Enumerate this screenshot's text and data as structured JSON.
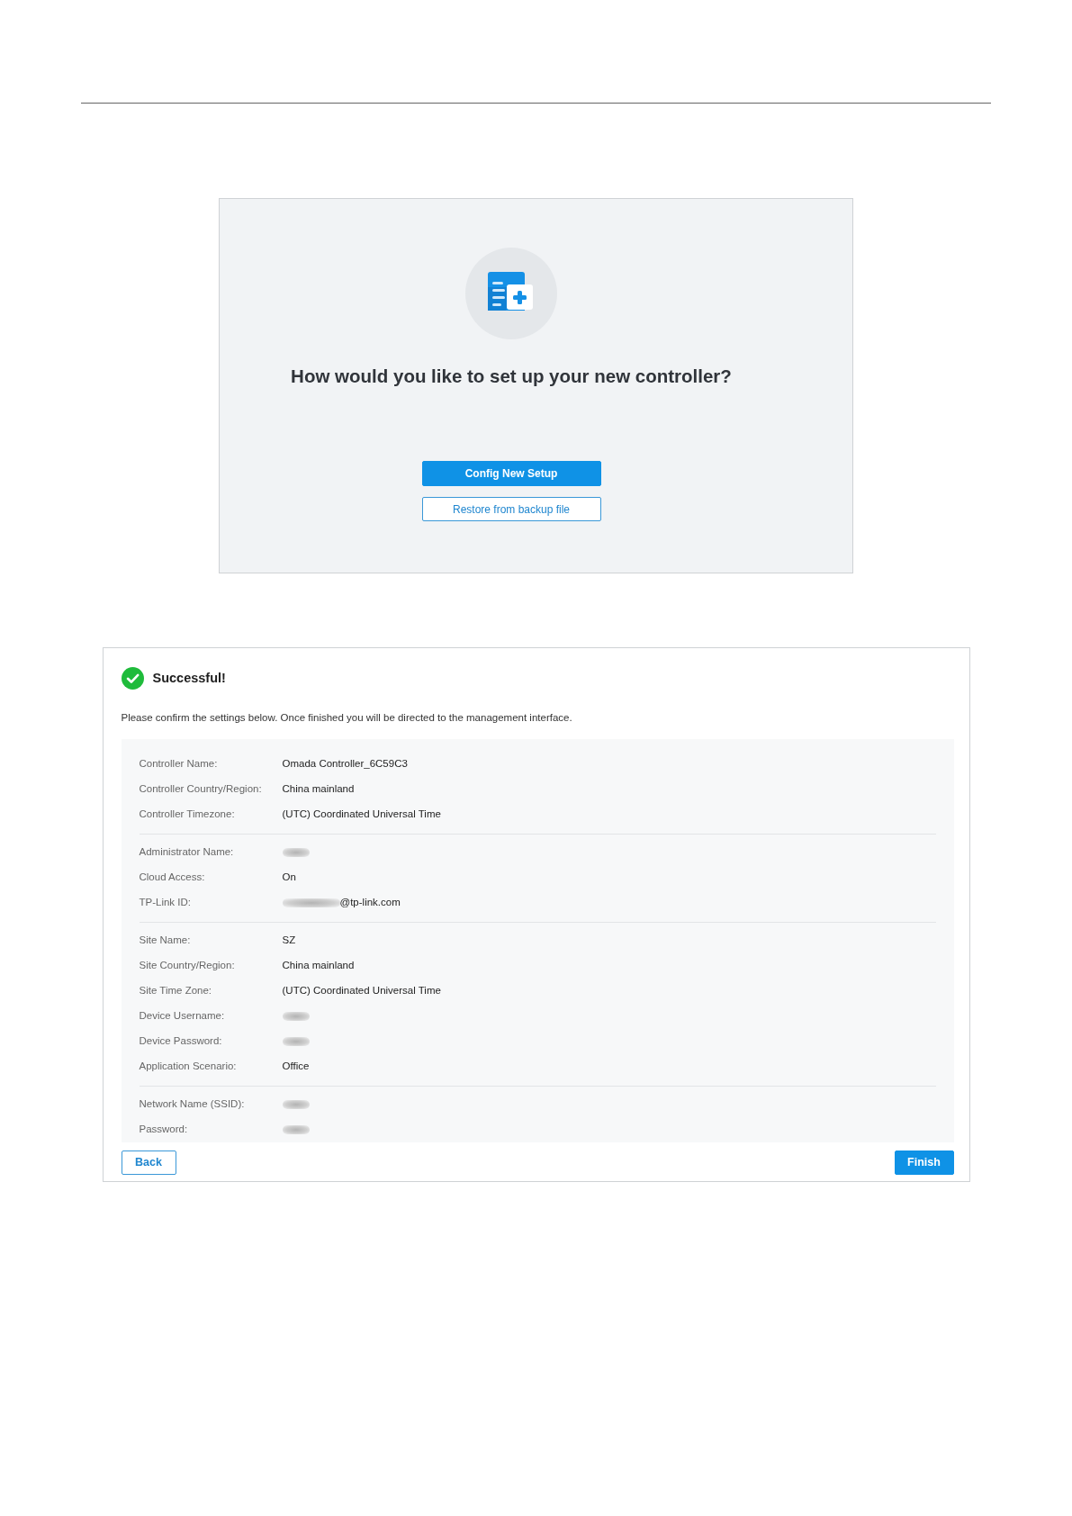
{
  "setup_panel": {
    "title": "How would you like to set up your new controller?",
    "buttons": [
      {
        "label": "Config New Setup",
        "kind": "primary"
      },
      {
        "label": "Restore from backup file",
        "kind": "outline"
      }
    ]
  },
  "summary_panel": {
    "status": {
      "title": "Successful!",
      "kind": "success"
    },
    "description": "Please confirm the settings below. Once finished you will be directed to the management interface.",
    "groups": [
      {
        "rows": [
          {
            "label": "Controller Name:",
            "value": "Omada Controller_6C59C3",
            "blurred": false
          },
          {
            "label": "Controller Country/Region:",
            "value": "China mainland",
            "blurred": false
          },
          {
            "label": "Controller Timezone:",
            "value": "(UTC) Coordinated Universal Time",
            "blurred": false
          }
        ]
      },
      {
        "rows": [
          {
            "label": "Administrator Name:",
            "blurred": true
          },
          {
            "label": "Cloud Access:",
            "value": "On",
            "blurred": false
          },
          {
            "label": "TP-Link ID:",
            "value": "@tp-link.com",
            "blurred": true
          }
        ]
      },
      {
        "rows": [
          {
            "label": "Site Name:",
            "value": "SZ",
            "blurred": false
          },
          {
            "label": "Site Country/Region:",
            "value": "China mainland",
            "blurred": false
          },
          {
            "label": "Site Time Zone:",
            "value": "(UTC) Coordinated Universal Time",
            "blurred": false
          },
          {
            "label": "Device Username:",
            "blurred": true
          },
          {
            "label": "Device Password:",
            "blurred": true
          },
          {
            "label": "Application Scenario:",
            "value": "Office",
            "blurred": false
          }
        ]
      },
      {
        "rows": [
          {
            "label": "Network Name (SSID):",
            "blurred": true
          },
          {
            "label": "Password:",
            "blurred": true
          }
        ]
      }
    ],
    "buttons": [
      {
        "label": "Back",
        "kind": "outline"
      },
      {
        "label": "Finish",
        "kind": "primary"
      }
    ]
  }
}
